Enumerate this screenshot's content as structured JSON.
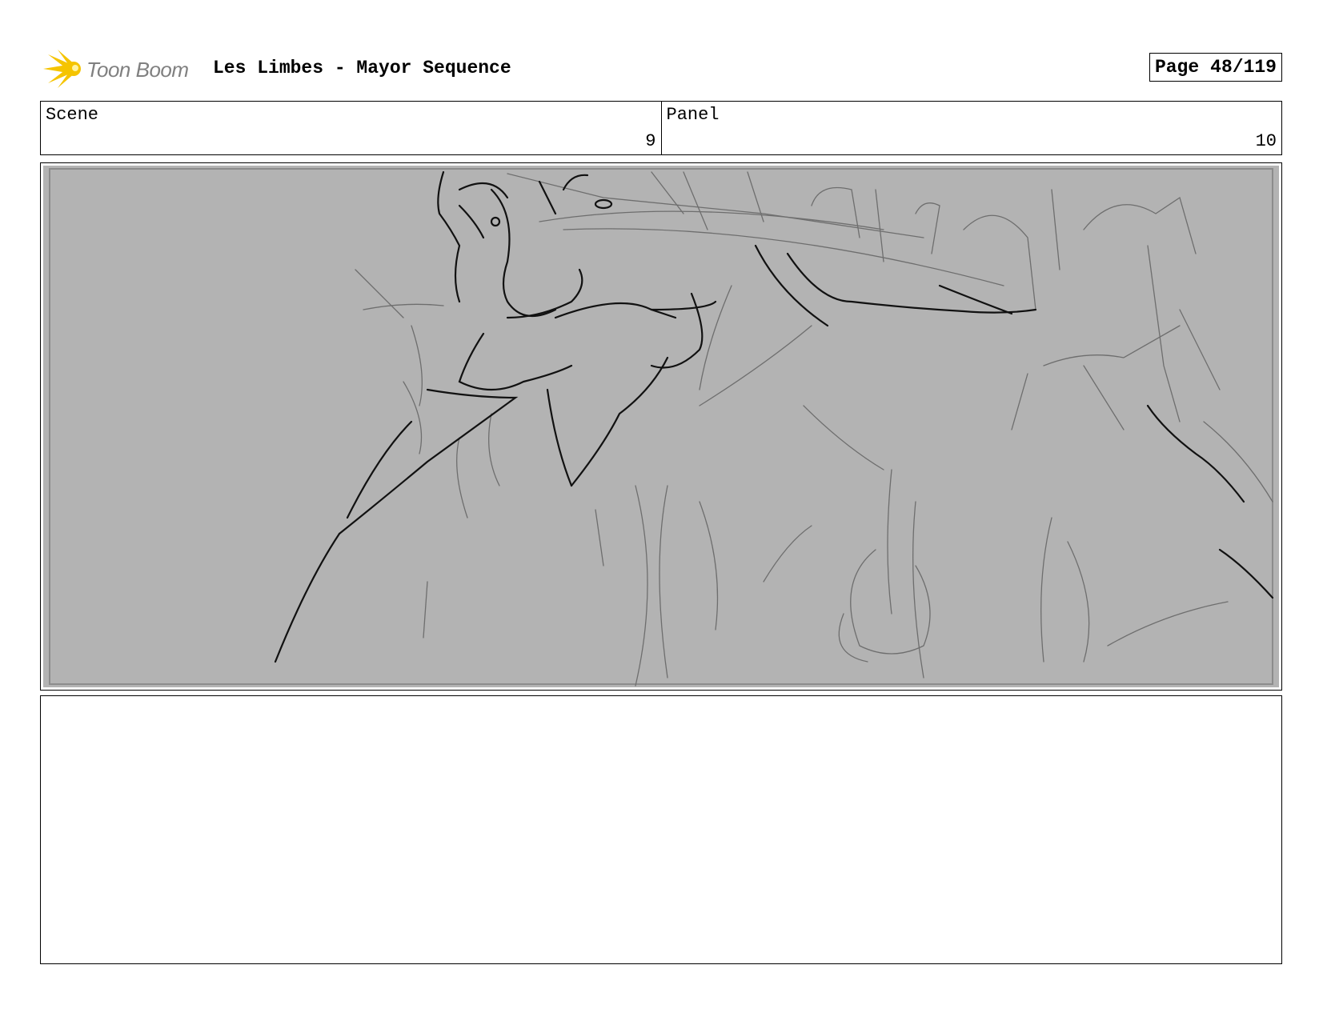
{
  "header": {
    "logo_text": "Toon Boom",
    "title": "Les Limbes - Mayor Sequence",
    "page_label": "Page",
    "page_number": "48/119"
  },
  "info": {
    "scene_label": "Scene",
    "scene_value": "9",
    "panel_label": "Panel",
    "panel_value": "10"
  },
  "panel": {
    "image_icon": "storyboard-sketch",
    "background_color": "#b3b3b3"
  },
  "colors": {
    "logo_yellow": "#f5c400",
    "logo_gray": "#808080",
    "sketch_dark": "#111111",
    "sketch_light": "#6e6e6e"
  }
}
